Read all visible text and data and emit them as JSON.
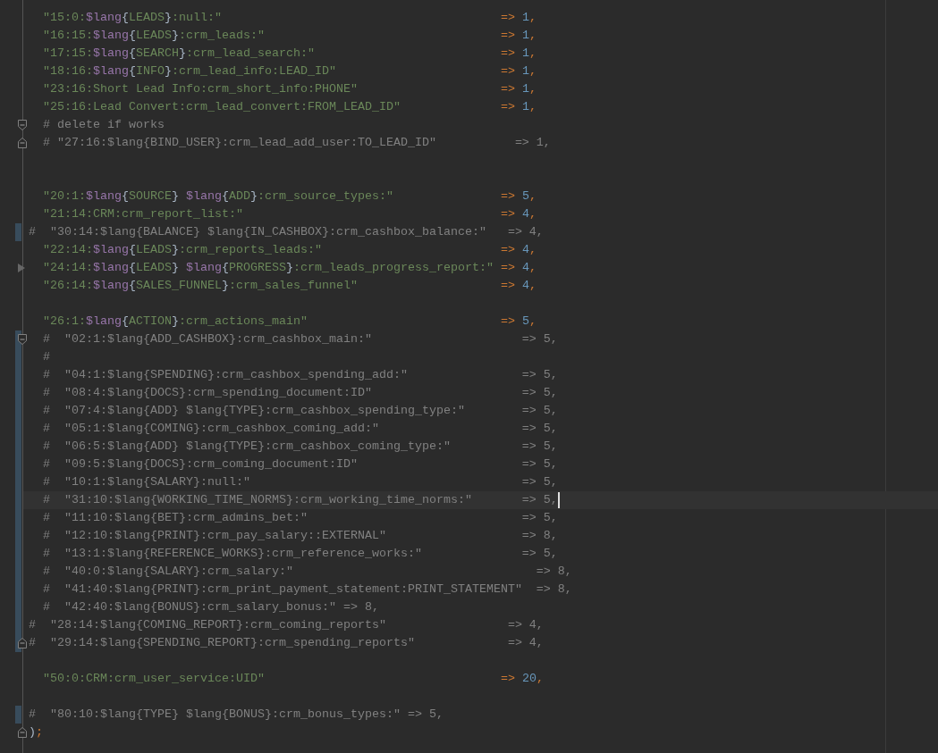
{
  "lines": [
    {
      "kind": "code",
      "changed": false,
      "current": false,
      "segments": [
        {
          "kind": "str",
          "text": "  \"15:0:"
        },
        {
          "kind": "var",
          "text": "$lang"
        },
        {
          "kind": "brace",
          "text": "{"
        },
        {
          "kind": "str",
          "text": "LEADS"
        },
        {
          "kind": "brace",
          "text": "}"
        },
        {
          "kind": "str",
          "text": ":null:\"                                       "
        },
        {
          "kind": "op",
          "text": "=> "
        },
        {
          "kind": "num",
          "text": "1"
        },
        {
          "kind": "op",
          "text": ","
        }
      ]
    },
    {
      "kind": "code",
      "changed": false,
      "current": false,
      "segments": [
        {
          "kind": "str",
          "text": "  \"16:15:"
        },
        {
          "kind": "var",
          "text": "$lang"
        },
        {
          "kind": "brace",
          "text": "{"
        },
        {
          "kind": "str",
          "text": "LEADS"
        },
        {
          "kind": "brace",
          "text": "}"
        },
        {
          "kind": "str",
          "text": ":crm_leads:\"                                 "
        },
        {
          "kind": "op",
          "text": "=> "
        },
        {
          "kind": "num",
          "text": "1"
        },
        {
          "kind": "op",
          "text": ","
        }
      ]
    },
    {
      "kind": "code",
      "changed": false,
      "current": false,
      "segments": [
        {
          "kind": "str",
          "text": "  \"17:15:"
        },
        {
          "kind": "var",
          "text": "$lang"
        },
        {
          "kind": "brace",
          "text": "{"
        },
        {
          "kind": "str",
          "text": "SEARCH"
        },
        {
          "kind": "brace",
          "text": "}"
        },
        {
          "kind": "str",
          "text": ":crm_lead_search:\"                          "
        },
        {
          "kind": "op",
          "text": "=> "
        },
        {
          "kind": "num",
          "text": "1"
        },
        {
          "kind": "op",
          "text": ","
        }
      ]
    },
    {
      "kind": "code",
      "changed": false,
      "current": false,
      "segments": [
        {
          "kind": "str",
          "text": "  \"18:16:"
        },
        {
          "kind": "var",
          "text": "$lang"
        },
        {
          "kind": "brace",
          "text": "{"
        },
        {
          "kind": "str",
          "text": "INFO"
        },
        {
          "kind": "brace",
          "text": "}"
        },
        {
          "kind": "str",
          "text": ":crm_lead_info:LEAD_ID\"                       "
        },
        {
          "kind": "op",
          "text": "=> "
        },
        {
          "kind": "num",
          "text": "1"
        },
        {
          "kind": "op",
          "text": ","
        }
      ]
    },
    {
      "kind": "code",
      "changed": false,
      "current": false,
      "segments": [
        {
          "kind": "str",
          "text": "  \"23:16:Short Lead Info:crm_short_info:PHONE\"                    "
        },
        {
          "kind": "op",
          "text": "=> "
        },
        {
          "kind": "num",
          "text": "1"
        },
        {
          "kind": "op",
          "text": ","
        }
      ]
    },
    {
      "kind": "code",
      "changed": false,
      "current": false,
      "segments": [
        {
          "kind": "str",
          "text": "  \"25:16:Lead Convert:crm_lead_convert:FROM_LEAD_ID\"              "
        },
        {
          "kind": "op",
          "text": "=> "
        },
        {
          "kind": "num",
          "text": "1"
        },
        {
          "kind": "op",
          "text": ","
        }
      ]
    },
    {
      "kind": "comment",
      "changed": false,
      "current": false,
      "gutter_icon": {
        "kind": "start"
      },
      "segments": [
        {
          "kind": "comment",
          "text": "  # delete if works"
        }
      ]
    },
    {
      "kind": "comment",
      "changed": false,
      "current": false,
      "gutter_icon": {
        "kind": "end"
      },
      "segments": [
        {
          "kind": "comment",
          "text": "  # \"27:16:$lang{BIND_USER}:crm_lead_add_user:TO_LEAD_ID\"           => 1,"
        }
      ]
    },
    {
      "kind": "blank",
      "changed": false,
      "current": false
    },
    {
      "kind": "blank",
      "changed": false,
      "current": false
    },
    {
      "kind": "code",
      "changed": false,
      "current": false,
      "segments": [
        {
          "kind": "str",
          "text": "  \"20:1:"
        },
        {
          "kind": "var",
          "text": "$lang"
        },
        {
          "kind": "brace",
          "text": "{"
        },
        {
          "kind": "str",
          "text": "SOURCE"
        },
        {
          "kind": "brace",
          "text": "} "
        },
        {
          "kind": "var",
          "text": "$lang"
        },
        {
          "kind": "brace",
          "text": "{"
        },
        {
          "kind": "str",
          "text": "ADD"
        },
        {
          "kind": "brace",
          "text": "}"
        },
        {
          "kind": "str",
          "text": ":crm_source_types:\"               "
        },
        {
          "kind": "op",
          "text": "=> "
        },
        {
          "kind": "num",
          "text": "5"
        },
        {
          "kind": "op",
          "text": ","
        }
      ]
    },
    {
      "kind": "code",
      "changed": false,
      "current": false,
      "segments": [
        {
          "kind": "str",
          "text": "  \"21:14:CRM:crm_report_list:\"                                    "
        },
        {
          "kind": "op",
          "text": "=> "
        },
        {
          "kind": "num",
          "text": "4"
        },
        {
          "kind": "op",
          "text": ","
        }
      ]
    },
    {
      "kind": "comment",
      "changed": true,
      "current": false,
      "segments": [
        {
          "kind": "comment",
          "text": "#  \"30:14:$lang{BALANCE} $lang{IN_CASHBOX}:crm_cashbox_balance:\"   => 4,"
        }
      ]
    },
    {
      "kind": "code",
      "changed": false,
      "current": false,
      "segments": [
        {
          "kind": "str",
          "text": "  \"22:14:"
        },
        {
          "kind": "var",
          "text": "$lang"
        },
        {
          "kind": "brace",
          "text": "{"
        },
        {
          "kind": "str",
          "text": "LEADS"
        },
        {
          "kind": "brace",
          "text": "}"
        },
        {
          "kind": "str",
          "text": ":crm_reports_leads:\"                         "
        },
        {
          "kind": "op",
          "text": "=> "
        },
        {
          "kind": "num",
          "text": "4"
        },
        {
          "kind": "op",
          "text": ","
        }
      ]
    },
    {
      "kind": "code",
      "changed": false,
      "current": false,
      "gutter_icon": {
        "kind": "arrow"
      },
      "segments": [
        {
          "kind": "str",
          "text": "  \"24:14:"
        },
        {
          "kind": "var",
          "text": "$lang"
        },
        {
          "kind": "brace",
          "text": "{"
        },
        {
          "kind": "str",
          "text": "LEADS"
        },
        {
          "kind": "brace",
          "text": "} "
        },
        {
          "kind": "var",
          "text": "$lang"
        },
        {
          "kind": "brace",
          "text": "{"
        },
        {
          "kind": "str",
          "text": "PROGRESS"
        },
        {
          "kind": "brace",
          "text": "}"
        },
        {
          "kind": "str",
          "text": ":crm_leads_progress_report:\" "
        },
        {
          "kind": "op",
          "text": "=> "
        },
        {
          "kind": "num",
          "text": "4"
        },
        {
          "kind": "op",
          "text": ","
        }
      ]
    },
    {
      "kind": "code",
      "changed": false,
      "current": false,
      "segments": [
        {
          "kind": "str",
          "text": "  \"26:14:"
        },
        {
          "kind": "var",
          "text": "$lang"
        },
        {
          "kind": "brace",
          "text": "{"
        },
        {
          "kind": "str",
          "text": "SALES_FUNNEL"
        },
        {
          "kind": "brace",
          "text": "}"
        },
        {
          "kind": "str",
          "text": ":crm_sales_funnel\"                    "
        },
        {
          "kind": "op",
          "text": "=> "
        },
        {
          "kind": "num",
          "text": "4"
        },
        {
          "kind": "op",
          "text": ","
        }
      ]
    },
    {
      "kind": "blank",
      "changed": false,
      "current": false
    },
    {
      "kind": "code",
      "changed": false,
      "current": false,
      "segments": [
        {
          "kind": "str",
          "text": "  \"26:1:"
        },
        {
          "kind": "var",
          "text": "$lang"
        },
        {
          "kind": "brace",
          "text": "{"
        },
        {
          "kind": "str",
          "text": "ACTION"
        },
        {
          "kind": "brace",
          "text": "}"
        },
        {
          "kind": "str",
          "text": ":crm_actions_main\"                           "
        },
        {
          "kind": "op",
          "text": "=> "
        },
        {
          "kind": "num",
          "text": "5"
        },
        {
          "kind": "op",
          "text": ","
        }
      ]
    },
    {
      "kind": "comment",
      "changed": true,
      "current": false,
      "gutter_icon": {
        "kind": "start"
      },
      "segments": [
        {
          "kind": "comment",
          "text": "  #  \"02:1:$lang{ADD_CASHBOX}:crm_cashbox_main:\"                     => 5,"
        }
      ]
    },
    {
      "kind": "comment",
      "changed": true,
      "current": false,
      "segments": [
        {
          "kind": "comment",
          "text": "  #"
        }
      ]
    },
    {
      "kind": "comment",
      "changed": true,
      "current": false,
      "segments": [
        {
          "kind": "comment",
          "text": "  #  \"04:1:$lang{SPENDING}:crm_cashbox_spending_add:\"                => 5,"
        }
      ]
    },
    {
      "kind": "comment",
      "changed": true,
      "current": false,
      "segments": [
        {
          "kind": "comment",
          "text": "  #  \"08:4:$lang{DOCS}:crm_spending_document:ID\"                     => 5,"
        }
      ]
    },
    {
      "kind": "comment",
      "changed": true,
      "current": false,
      "segments": [
        {
          "kind": "comment",
          "text": "  #  \"07:4:$lang{ADD} $lang{TYPE}:crm_cashbox_spending_type:\"        => 5,"
        }
      ]
    },
    {
      "kind": "comment",
      "changed": true,
      "current": false,
      "segments": [
        {
          "kind": "comment",
          "text": "  #  \"05:1:$lang{COMING}:crm_cashbox_coming_add:\"                    => 5,"
        }
      ]
    },
    {
      "kind": "comment",
      "changed": true,
      "current": false,
      "segments": [
        {
          "kind": "comment",
          "text": "  #  \"06:5:$lang{ADD} $lang{TYPE}:crm_cashbox_coming_type:\"          => 5,"
        }
      ]
    },
    {
      "kind": "comment",
      "changed": true,
      "current": false,
      "segments": [
        {
          "kind": "comment",
          "text": "  #  \"09:5:$lang{DOCS}:crm_coming_document:ID\"                       => 5,"
        }
      ]
    },
    {
      "kind": "comment",
      "changed": true,
      "current": false,
      "segments": [
        {
          "kind": "comment",
          "text": "  #  \"10:1:$lang{SALARY}:null:\"                                      => 5,"
        }
      ]
    },
    {
      "kind": "comment",
      "changed": true,
      "current": true,
      "segments": [
        {
          "kind": "comment",
          "text": "  #  \"31:10:$lang{WORKING_TIME_NORMS}:crm_working_time_norms:\"       => 5,"
        }
      ]
    },
    {
      "kind": "comment",
      "changed": true,
      "current": false,
      "segments": [
        {
          "kind": "comment",
          "text": "  #  \"11:10:$lang{BET}:crm_admins_bet:\"                              => 5,"
        }
      ]
    },
    {
      "kind": "comment",
      "changed": true,
      "current": false,
      "segments": [
        {
          "kind": "comment",
          "text": "  #  \"12:10:$lang{PRINT}:crm_pay_salary::EXTERNAL\"                   => 8,"
        }
      ]
    },
    {
      "kind": "comment",
      "changed": true,
      "current": false,
      "segments": [
        {
          "kind": "comment",
          "text": "  #  \"13:1:$lang{REFERENCE_WORKS}:crm_reference_works:\"              => 5,"
        }
      ]
    },
    {
      "kind": "comment",
      "changed": true,
      "current": false,
      "segments": [
        {
          "kind": "comment",
          "text": "  #  \"40:0:$lang{SALARY}:crm_salary:\"                                  => 8,"
        }
      ]
    },
    {
      "kind": "comment",
      "changed": true,
      "current": false,
      "segments": [
        {
          "kind": "comment",
          "text": "  #  \"41:40:$lang{PRINT}:crm_print_payment_statement:PRINT_STATEMENT\"  => 8,"
        }
      ]
    },
    {
      "kind": "comment",
      "changed": true,
      "current": false,
      "segments": [
        {
          "kind": "comment",
          "text": "  #  \"42:40:$lang{BONUS}:crm_salary_bonus:\" => 8,"
        }
      ]
    },
    {
      "kind": "comment",
      "changed": true,
      "current": false,
      "segments": [
        {
          "kind": "comment",
          "text": "#  \"28:14:$lang{COMING_REPORT}:crm_coming_reports\"                 => 4,"
        }
      ]
    },
    {
      "kind": "comment",
      "changed": true,
      "current": false,
      "gutter_icon": {
        "kind": "end"
      },
      "segments": [
        {
          "kind": "comment",
          "text": "#  \"29:14:$lang{SPENDING_REPORT}:crm_spending_reports\"             => 4,"
        }
      ]
    },
    {
      "kind": "blank",
      "changed": false,
      "current": false
    },
    {
      "kind": "code",
      "changed": false,
      "current": false,
      "segments": [
        {
          "kind": "str",
          "text": "  \"50:0:CRM:crm_user_service:UID\"                                 "
        },
        {
          "kind": "op",
          "text": "=> "
        },
        {
          "kind": "num",
          "text": "20"
        },
        {
          "kind": "op",
          "text": ","
        }
      ]
    },
    {
      "kind": "blank",
      "changed": false,
      "current": false
    },
    {
      "kind": "comment",
      "changed": true,
      "current": false,
      "segments": [
        {
          "kind": "comment",
          "text": "#  \"80:10:$lang{TYPE} $lang{BONUS}:crm_bonus_types:\" => 5,"
        }
      ]
    },
    {
      "kind": "code",
      "changed": false,
      "current": false,
      "gutter_icon": {
        "kind": "end"
      },
      "segments": [
        {
          "kind": "plain",
          "text": ")"
        },
        {
          "kind": "op",
          "text": ";"
        }
      ]
    }
  ]
}
